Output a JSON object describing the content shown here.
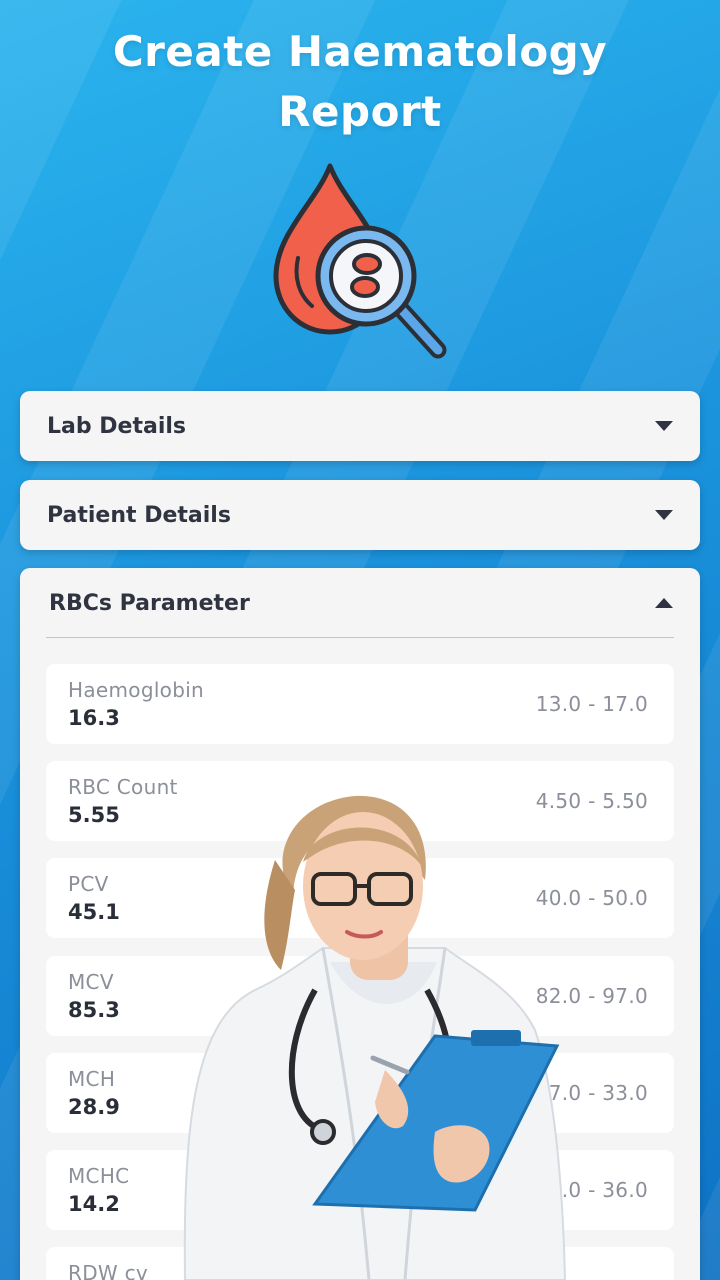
{
  "header": {
    "title_line1": "Create Haematology",
    "title_line2": "Report",
    "hero_icon": "blood-drop-magnifier-icon"
  },
  "sections": {
    "lab": {
      "label": "Lab Details",
      "state": "collapsed"
    },
    "patient": {
      "label": "Patient Details",
      "state": "collapsed"
    },
    "rbc": {
      "label": "RBCs Parameter",
      "state": "expanded"
    }
  },
  "parameters": [
    {
      "name": "Haemoglobin",
      "value": "16.3",
      "range": "13.0 - 17.0"
    },
    {
      "name": "RBC Count",
      "value": "5.55",
      "range": "4.50 - 5.50"
    },
    {
      "name": "PCV",
      "value": "45.1",
      "range": "40.0 - 50.0"
    },
    {
      "name": "MCV",
      "value": "85.3",
      "range": "82.0 - 97.0"
    },
    {
      "name": "MCH",
      "value": "28.9",
      "range": "27.0 - 33.0"
    },
    {
      "name": "MCHC",
      "value": "14.2",
      "range": "32.0 - 36.0"
    },
    {
      "name": "RDW cv",
      "value": "",
      "range": ""
    }
  ],
  "colors": {
    "background": "#1a92dc",
    "card": "#f5f5f6",
    "drop": "#f0604a",
    "magnifier": "#5aa6e8"
  }
}
